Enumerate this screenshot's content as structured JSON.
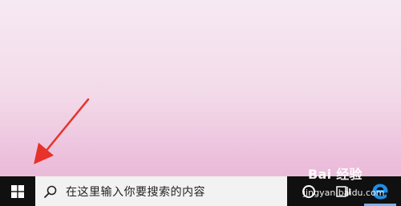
{
  "taskbar": {
    "search_placeholder": "在这里输入你要搜索的内容",
    "start_icon": "windows-logo-icon",
    "search_icon": "search-icon",
    "cortana_icon": "cortana-icon",
    "taskview_icon": "task-view-icon",
    "pinned": [
      {
        "name": "Microsoft Edge",
        "icon": "edge-icon",
        "active": true
      }
    ]
  },
  "annotation": {
    "type": "arrow",
    "color": "#e8312b",
    "points_to": "start-button"
  },
  "watermark": {
    "logo": "Bai 经验",
    "sub": "jingyan.baidu.com"
  },
  "colors": {
    "taskbar": "#101010",
    "search_box": "#f2f2f2",
    "desktop_top": "#f6e9f2",
    "desktop_bottom": "#e7b3d5",
    "edge_blue": "#1f6fd1"
  }
}
